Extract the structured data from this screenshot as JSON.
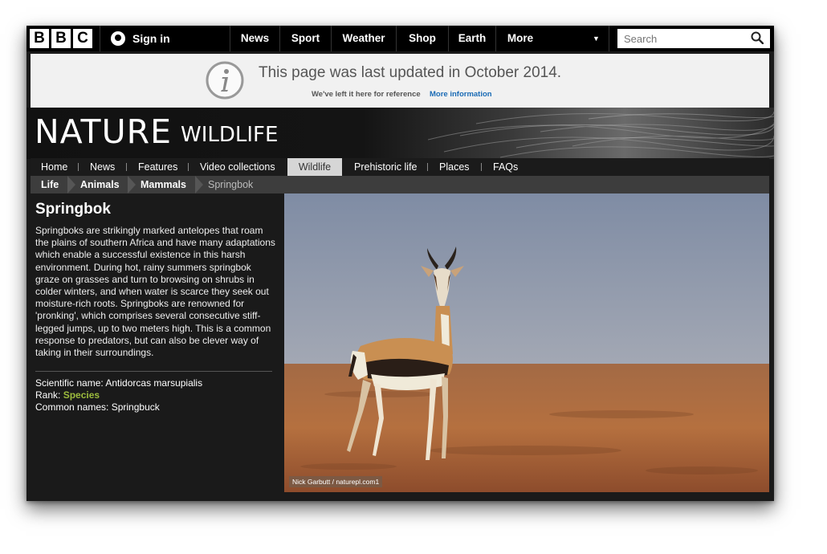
{
  "topbar": {
    "logo_letters": [
      "B",
      "B",
      "C"
    ],
    "signin": "Sign in",
    "nav": [
      "News",
      "Sport",
      "Weather",
      "Shop",
      "Earth",
      "More"
    ],
    "search_placeholder": "Search"
  },
  "notice": {
    "message": "This page was last updated in October 2014.",
    "sub": "We've left it here for reference",
    "link": "More information"
  },
  "header": {
    "brand": "NATURE",
    "section": "WILDLIFE"
  },
  "subnav": {
    "items": [
      "Home",
      "News",
      "Features",
      "Video collections",
      "Wildlife",
      "Prehistoric life",
      "Places",
      "FAQs"
    ],
    "active": "Wildlife"
  },
  "breadcrumb": [
    "Life",
    "Animals",
    "Mammals",
    "Springbok"
  ],
  "article": {
    "title": "Springbok",
    "description": "Springboks are strikingly marked antelopes that roam the plains of southern Africa and have many adaptations which enable a successful existence in this harsh environment. During hot, rainy summers springbok graze on grasses and turn to browsing on shrubs in colder winters, and when water is scarce they seek out moisture-rich roots. Springboks are renowned for 'pronking', which comprises several consecutive stiff-legged jumps, up to two meters high. This is a common response to predators, but can also be clever way of taking in their surroundings.",
    "scientific_label": "Scientific name: ",
    "scientific_value": "Antidorcas marsupialis",
    "rank_label": "Rank: ",
    "rank_value": "Species",
    "common_label": "Common names: ",
    "common_value": "Springbuck"
  },
  "photo": {
    "credit": "Nick Garbutt / naturepl.com1"
  },
  "colors": {
    "rank_link": "#9cbb3d",
    "info_link": "#1a6bb5",
    "sky": "#8e9bb2",
    "ground": "#b06a3c"
  }
}
